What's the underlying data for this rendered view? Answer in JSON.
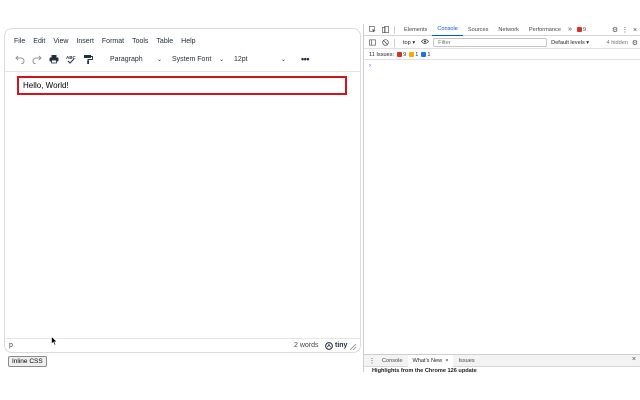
{
  "editor": {
    "menubar": [
      "File",
      "Edit",
      "View",
      "Insert",
      "Format",
      "Tools",
      "Table",
      "Help"
    ],
    "toolbar": {
      "block_format": "Paragraph",
      "font_family": "System Font",
      "font_size": "12pt",
      "more_label": "•••"
    },
    "content_text": "Hello, World!",
    "status": {
      "path": "p",
      "word_count": "2 words",
      "brand": "tiny"
    }
  },
  "inline_css_button": "Inline CSS",
  "devtools": {
    "tabs": [
      "Elements",
      "Console",
      "Sources",
      "Network",
      "Performance"
    ],
    "active_tab": "Console",
    "more_tabs": "»",
    "error_count": "9",
    "context": "top",
    "filter_placeholder": "Filter",
    "levels": "Default levels",
    "hidden": "4 hidden",
    "issues": {
      "label": "11 Issues:",
      "errors": "9",
      "warnings": "1",
      "info": "1"
    },
    "prompt": "›",
    "drawer": {
      "tabs": [
        "Console",
        "What's New",
        "Issues"
      ],
      "active": "What's New",
      "close_mark": "×",
      "text": "Highlights from the Chrome 126 update"
    }
  },
  "colors": {
    "highlight_border": "#d4131d",
    "accent": "#0b57d0",
    "error": "#d93025",
    "warning": "#f9ab00",
    "info": "#1a73e8"
  }
}
